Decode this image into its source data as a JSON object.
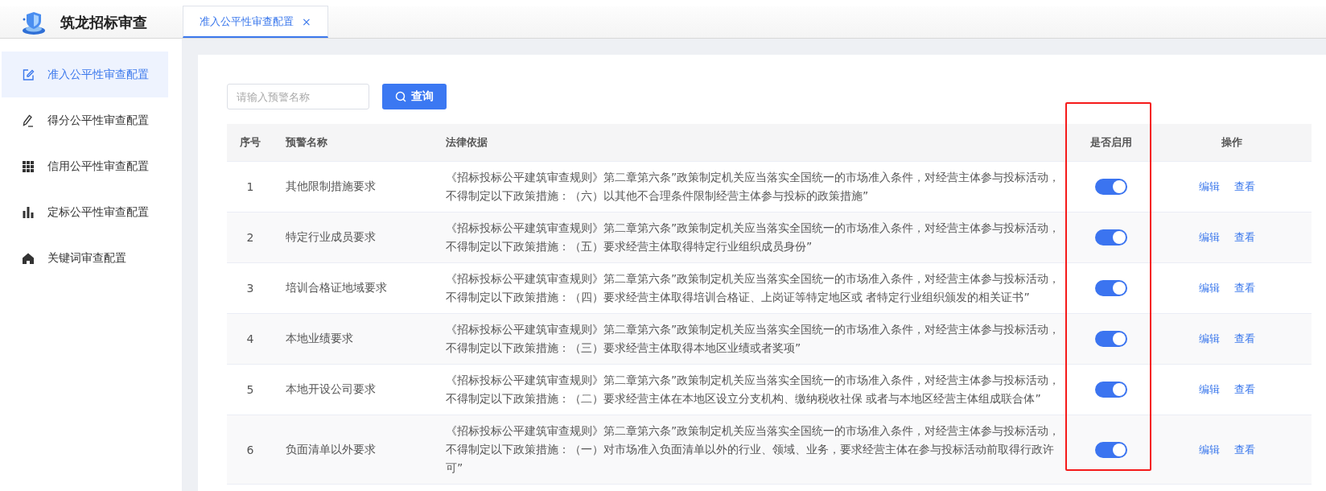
{
  "app": {
    "title": "筑龙招标审查"
  },
  "tabs": [
    {
      "label": "准入公平性审查配置",
      "close": "×",
      "selected": true
    }
  ],
  "sidebar": {
    "items": [
      {
        "label": "准入公平性审查配置",
        "selected": true
      },
      {
        "label": "得分公平性审查配置",
        "selected": false
      },
      {
        "label": "信用公平性审查配置",
        "selected": false
      },
      {
        "label": "定标公平性审查配置",
        "selected": false
      },
      {
        "label": "关键词审查配置",
        "selected": false
      }
    ]
  },
  "search": {
    "placeholder": "请输入预警名称",
    "button": "查询"
  },
  "table": {
    "columns": [
      "序号",
      "预警名称",
      "法律依据",
      "是否启用",
      "操作"
    ],
    "rows": [
      {
        "no": "1",
        "name": "其他限制措施要求",
        "basis": "《招标投标公平建筑审查规则》第二章第六条”政策制定机关应当落实全国统一的市场准入条件，对经营主体参与投标活动，不得制定以下政策措施：（六）以其他不合理条件限制经营主体参与投标的政策措施”",
        "enabled": true,
        "actions": [
          "编辑",
          "查看"
        ]
      },
      {
        "no": "2",
        "name": "特定行业成员要求",
        "basis": "《招标投标公平建筑审查规则》第二章第六条”政策制定机关应当落实全国统一的市场准入条件，对经营主体参与投标活动，不得制定以下政策措施：（五）要求经营主体取得特定行业组织成员身份”",
        "enabled": true,
        "actions": [
          "编辑",
          "查看"
        ]
      },
      {
        "no": "3",
        "name": "培训合格证地域要求",
        "basis": "《招标投标公平建筑审查规则》第二章第六条”政策制定机关应当落实全国统一的市场准入条件，对经营主体参与投标活动，不得制定以下政策措施：（四）要求经营主体取得培训合格证、上岗证等特定地区或 者特定行业组织颁发的相关证书”",
        "enabled": true,
        "actions": [
          "编辑",
          "查看"
        ]
      },
      {
        "no": "4",
        "name": "本地业绩要求",
        "basis": "《招标投标公平建筑审查规则》第二章第六条”政策制定机关应当落实全国统一的市场准入条件，对经营主体参与投标活动，不得制定以下政策措施：（三）要求经营主体取得本地区业绩或者奖项”",
        "enabled": true,
        "actions": [
          "编辑",
          "查看"
        ]
      },
      {
        "no": "5",
        "name": "本地开设公司要求",
        "basis": "《招标投标公平建筑审查规则》第二章第六条”政策制定机关应当落实全国统一的市场准入条件，对经营主体参与投标活动，不得制定以下政策措施：（二）要求经营主体在本地区设立分支机构、缴纳税收社保 或者与本地区经营主体组成联合体”",
        "enabled": true,
        "actions": [
          "编辑",
          "查看"
        ]
      },
      {
        "no": "6",
        "name": "负面清单以外要求",
        "basis": "《招标投标公平建筑审查规则》第二章第六条”政策制定机关应当落实全国统一的市场准入条件，对经营主体参与投标活动，不得制定以下政策措施：（一）对市场准入负面清单以外的行业、领域、业务，要求经营主体在参与投标活动前取得行政许可”",
        "enabled": true,
        "actions": [
          "编辑",
          "查看"
        ]
      }
    ]
  }
}
